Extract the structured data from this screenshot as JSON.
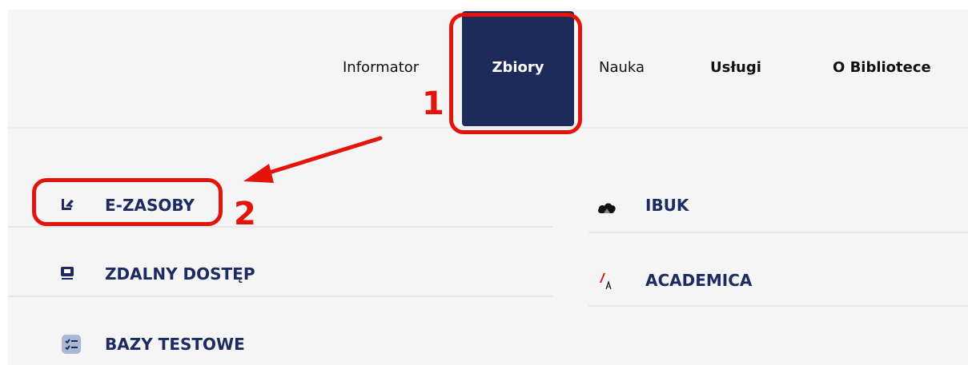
{
  "nav": {
    "items": [
      {
        "label": "Informator"
      },
      {
        "label": "Zbiory"
      },
      {
        "label": "Nauka"
      },
      {
        "label": "Usługi"
      },
      {
        "label": "O Bibliotece"
      }
    ],
    "active_index": 1
  },
  "menu": {
    "left": [
      {
        "label": "E-ZASOBY",
        "icon": "e-resources-icon"
      },
      {
        "label": "ZDALNY DOSTĘP",
        "icon": "monitor-icon"
      },
      {
        "label": "BAZY TESTOWE",
        "icon": "checklist-icon"
      }
    ],
    "right": [
      {
        "label": "IBUK",
        "icon": "cloud-icon"
      },
      {
        "label": "ACADEMICA",
        "icon": "academica-logo"
      }
    ]
  },
  "annotations": {
    "step1": "1",
    "step2": "2"
  },
  "colors": {
    "accent": "#1c2b5a",
    "menu_text": "#1d2b63",
    "annotation": "#e3140c",
    "background": "#f5f5f5"
  }
}
